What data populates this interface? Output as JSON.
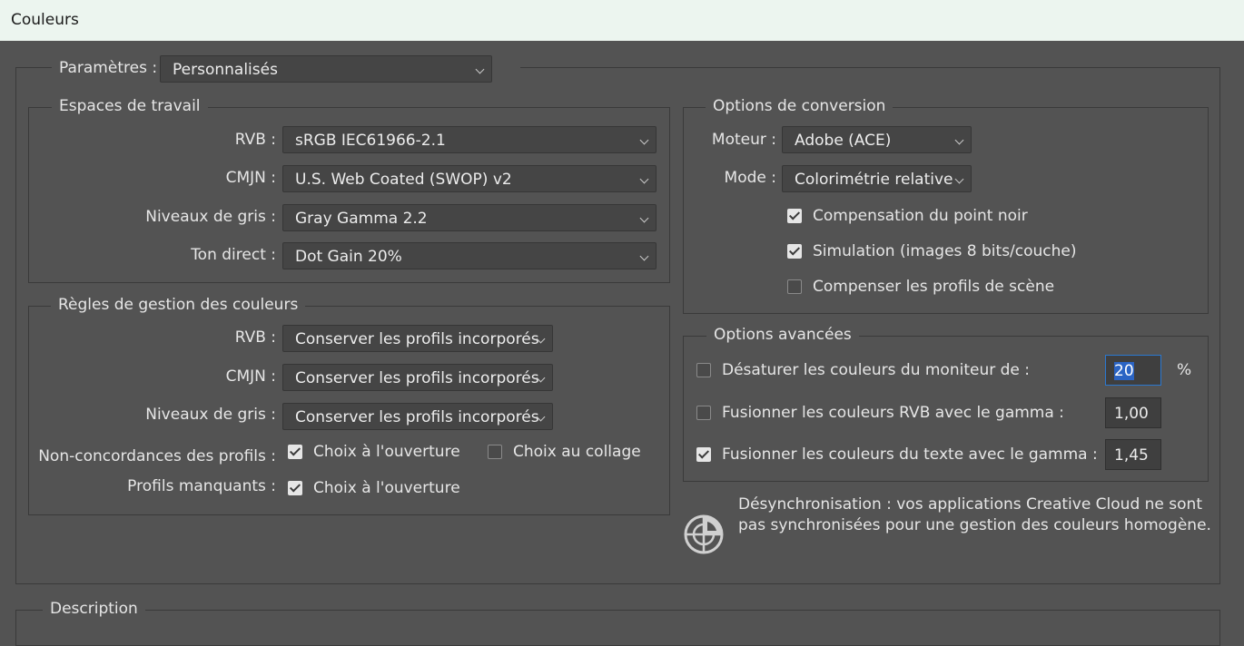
{
  "window": {
    "title": "Couleurs"
  },
  "settings": {
    "label": "Paramètres :",
    "value": "Personnalisés"
  },
  "working_spaces": {
    "legend": "Espaces de travail",
    "rows": [
      {
        "label": "RVB :",
        "value": "sRGB IEC61966-2.1"
      },
      {
        "label": "CMJN :",
        "value": "U.S. Web Coated (SWOP) v2"
      },
      {
        "label": "Niveaux de gris :",
        "value": "Gray Gamma 2.2"
      },
      {
        "label": "Ton direct :",
        "value": "Dot Gain 20%"
      }
    ]
  },
  "policies": {
    "legend": "Règles de gestion des couleurs",
    "rows": [
      {
        "label": "RVB :",
        "value": "Conserver les profils incorporés"
      },
      {
        "label": "CMJN :",
        "value": "Conserver les profils incorporés"
      },
      {
        "label": "Niveaux de gris :",
        "value": "Conserver les profils incorporés"
      }
    ],
    "mismatch_label": "Non-concordances des profils :",
    "mismatch_open": {
      "label": "Choix à l'ouverture",
      "checked": true
    },
    "mismatch_paste": {
      "label": "Choix au collage",
      "checked": false
    },
    "missing_label": "Profils manquants :",
    "missing_open": {
      "label": "Choix à l'ouverture",
      "checked": true
    }
  },
  "conversion": {
    "legend": "Options de conversion",
    "engine_label": "Moteur :",
    "engine_value": "Adobe (ACE)",
    "intent_label": "Mode :",
    "intent_value": "Colorimétrie relative",
    "black_point": {
      "label": "Compensation du point noir",
      "checked": true
    },
    "dither": {
      "label": "Simulation (images 8 bits/couche)",
      "checked": true
    },
    "scene_profiles": {
      "label": "Compenser les profils de scène",
      "checked": false
    }
  },
  "advanced": {
    "legend": "Options avancées",
    "desaturate": {
      "label": "Désaturer les couleurs du moniteur de :",
      "checked": false,
      "value": "20",
      "unit": "%"
    },
    "blend_rgb": {
      "label": "Fusionner les couleurs RVB avec le gamma :",
      "checked": false,
      "value": "1,00"
    },
    "blend_text": {
      "label": "Fusionner les couleurs du texte avec le gamma :",
      "checked": true,
      "value": "1,45"
    }
  },
  "sync": {
    "line1": "Désynchronisation : vos applications Creative Cloud ne sont",
    "line2": "pas synchronisées pour une gestion des couleurs homogène."
  },
  "description": {
    "legend": "Description"
  }
}
